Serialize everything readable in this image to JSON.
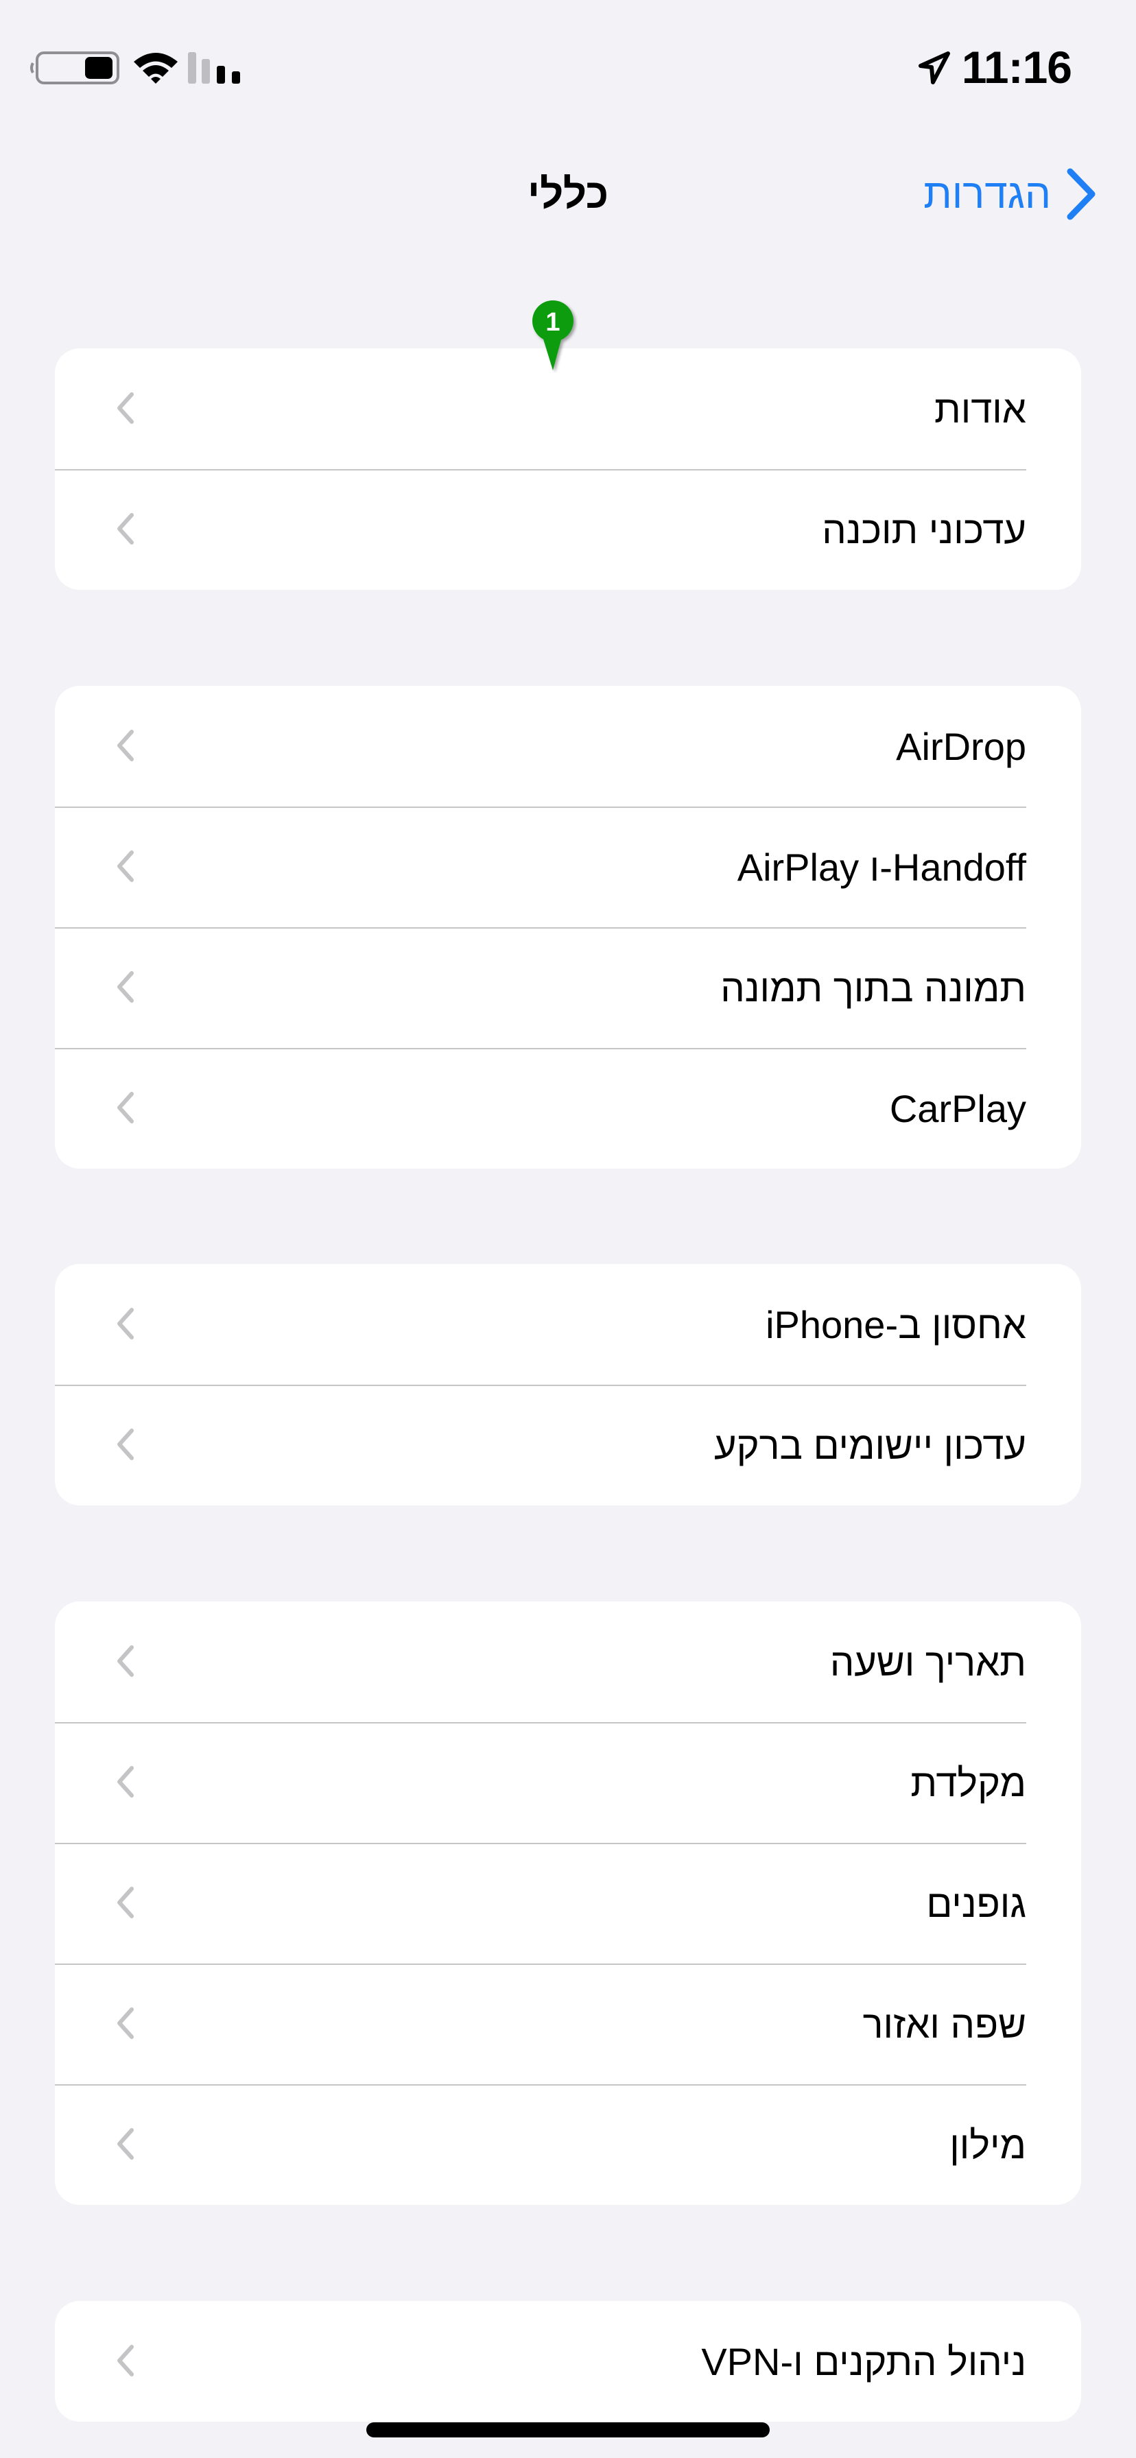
{
  "status_bar": {
    "time": "11:16",
    "icons": [
      "battery-icon",
      "wifi-icon",
      "cellular-signal-icon",
      "location-arrow-icon"
    ]
  },
  "nav": {
    "back_label": "הגדרות",
    "title": "כללי"
  },
  "accent_color": "#1f7ff5",
  "marker": {
    "label": "1",
    "color": "#119c11"
  },
  "groups": [
    {
      "items": [
        {
          "label": "אודות"
        },
        {
          "label": "עדכוני תוכנה"
        }
      ]
    },
    {
      "items": [
        {
          "label": "AirDrop"
        },
        {
          "label": "Handoff-ו AirPlay"
        },
        {
          "label": "תמונה בתוך תמונה"
        },
        {
          "label": "CarPlay"
        }
      ]
    },
    {
      "items": [
        {
          "label": "אחסון ב-iPhone"
        },
        {
          "label": "עדכון יישומים ברקע"
        }
      ]
    },
    {
      "items": [
        {
          "label": "תאריך ושעה"
        },
        {
          "label": "מקלדת"
        },
        {
          "label": "גופנים"
        },
        {
          "label": "שפה ואזור"
        },
        {
          "label": "מילון"
        }
      ]
    },
    {
      "items": [
        {
          "label": "ניהול התקנים ו-VPN"
        }
      ]
    }
  ]
}
